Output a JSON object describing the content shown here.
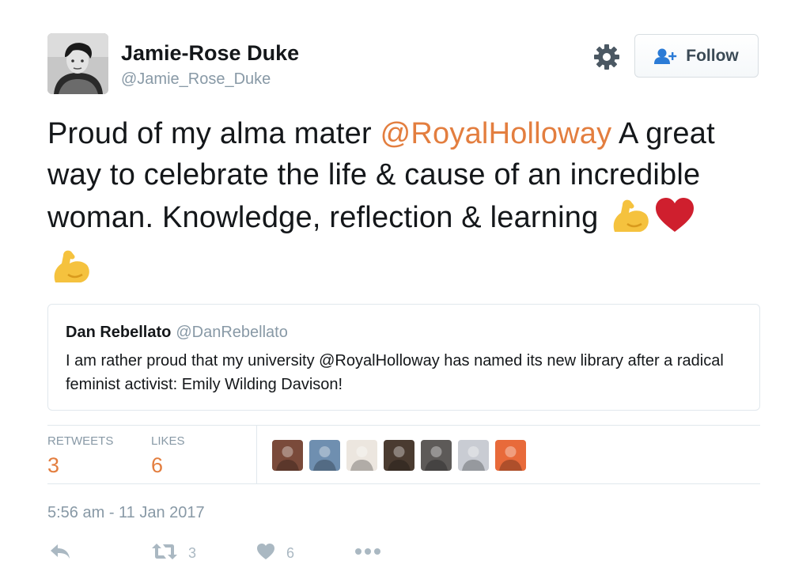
{
  "author": {
    "name": "Jamie-Rose Duke",
    "handle": "@Jamie_Rose_Duke"
  },
  "header": {
    "follow_label": "Follow",
    "settings_icon": "gear-icon"
  },
  "tweet": {
    "text_before": "Proud of my alma mater ",
    "mention": "@RoyalHolloway",
    "text_after": " A great way to celebrate the life & cause of an incredible woman. Knowledge, reflection & learning",
    "emojis": [
      "flexed-biceps-icon",
      "red-heart-icon",
      "flexed-biceps-icon"
    ]
  },
  "quoted_tweet": {
    "name": "Dan Rebellato",
    "handle": "@DanRebellato",
    "text": "I am rather proud that my university @RoyalHolloway has named its new library after a radical feminist activist: Emily Wilding Davison!"
  },
  "stats": {
    "retweets_label": "RETWEETS",
    "retweets_count": "3",
    "likes_label": "LIKES",
    "likes_count": "6"
  },
  "likers": [
    {
      "name": "liker-avatar-1",
      "color": "#7a4a3a"
    },
    {
      "name": "liker-avatar-2",
      "color": "#6f8fb0"
    },
    {
      "name": "liker-avatar-3",
      "color": "#ece6df"
    },
    {
      "name": "liker-avatar-4",
      "color": "#4a3b30"
    },
    {
      "name": "liker-avatar-5",
      "color": "#5d5a58"
    },
    {
      "name": "liker-avatar-6",
      "color": "#c9ccd3"
    },
    {
      "name": "liker-avatar-7",
      "color": "#e86a3a"
    }
  ],
  "timestamp": "5:56 am - 11 Jan 2017",
  "actions": {
    "retweet_count": "3",
    "like_count": "6"
  },
  "colors": {
    "accent": "#e37e3f",
    "muted": "#8899a6",
    "icon": "#aab8c2"
  }
}
